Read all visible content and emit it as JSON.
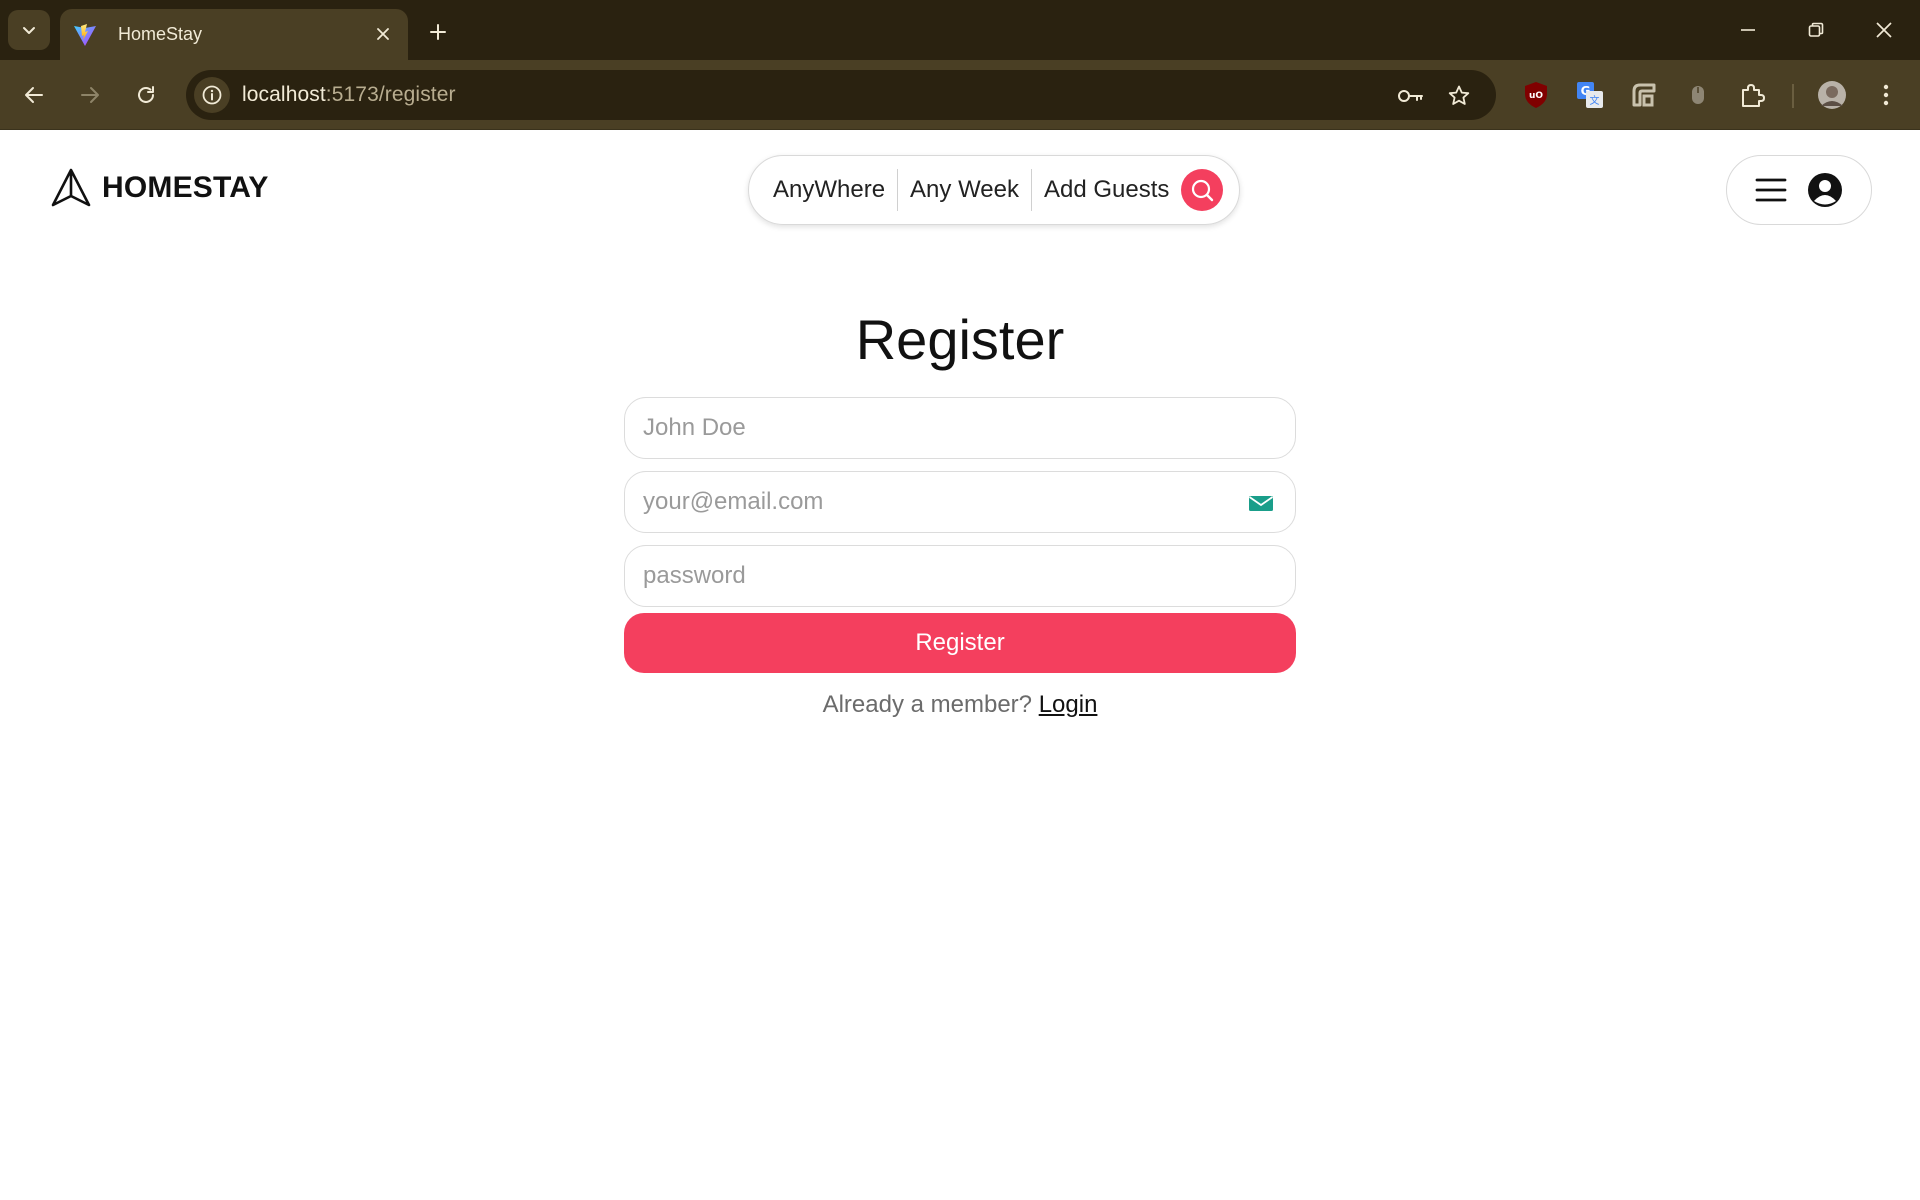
{
  "browser": {
    "tab_title": "HomeStay",
    "url_host": "localhost",
    "url_path": ":5173/register"
  },
  "header": {
    "logo_text": "HOMESTAY",
    "search": {
      "where": "AnyWhere",
      "week": "Any Week",
      "guests": "Add Guests"
    }
  },
  "form": {
    "title": "Register",
    "name_placeholder": "John Doe",
    "email_placeholder": "your@email.com",
    "password_placeholder": "password",
    "submit_label": "Register",
    "member_text": "Already a member?",
    "login_link": "Login"
  },
  "colors": {
    "accent": "#f43f5e",
    "chrome_dark": "#2a2210",
    "chrome_mid": "#4a3f24"
  }
}
